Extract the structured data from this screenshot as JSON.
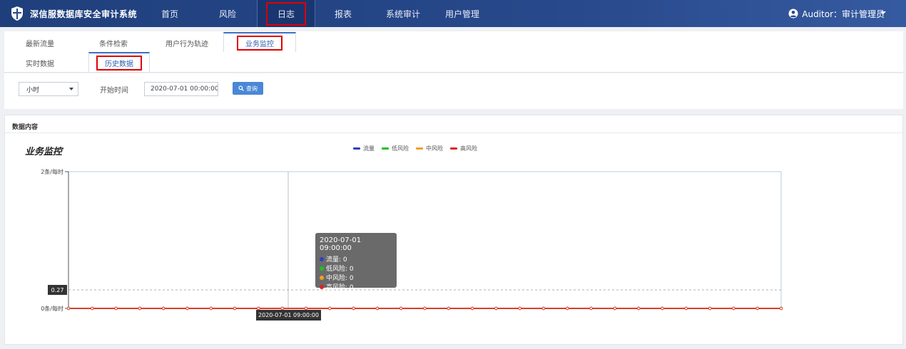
{
  "app": {
    "title": "深信服数据库安全审计系统"
  },
  "nav": {
    "items": [
      "首页",
      "风险",
      "日志",
      "报表",
      "系统审计",
      "用户管理"
    ],
    "active": "日志"
  },
  "user": {
    "label": "Auditor：审计管理员"
  },
  "tabs_row1": [
    "最新流量",
    "条件检索",
    "用户行为轨迹",
    "业务监控"
  ],
  "tabs_row2": [
    "实时数据",
    "历史数据"
  ],
  "filter": {
    "granularity": "小时",
    "start_label": "开始时间",
    "start_value": "2020-07-01 00:00:00",
    "search_label": "查询"
  },
  "panel": {
    "title": "数据内容"
  },
  "tooltip": {
    "time": "2020-07-01 09:00:00",
    "rows": [
      "流量: 0",
      "低风险: 0",
      "中风险: 0",
      "高风险: 0"
    ]
  },
  "crosshair": {
    "y_value": "0.27",
    "x_value": "2020-07-01 09:00:00"
  },
  "colors": {
    "traffic": "#2f3fbf",
    "low": "#1ec21e",
    "mid": "#f0a020",
    "high": "#e02020",
    "nav_bg": "#27488a",
    "accent": "#3b71c4"
  },
  "chart_data": {
    "type": "line",
    "title": "业务监控",
    "yticks": [
      "0条/每时",
      "2条/每时"
    ],
    "ylim": [
      0,
      2
    ],
    "point_count": 31,
    "legend": [
      "流量",
      "低风险",
      "中风险",
      "高风险"
    ],
    "series": [
      {
        "name": "流量",
        "color": "#2f3fbf",
        "values": [
          0,
          0,
          0,
          0,
          0,
          0,
          0,
          0,
          0,
          0,
          0,
          0,
          0,
          0,
          0,
          0,
          0,
          0,
          0,
          0,
          0,
          0,
          0,
          0,
          0,
          0,
          0,
          0,
          0,
          0,
          0
        ]
      },
      {
        "name": "低风险",
        "color": "#1ec21e",
        "values": [
          0,
          0,
          0,
          0,
          0,
          0,
          0,
          0,
          0,
          0,
          0,
          0,
          0,
          0,
          0,
          0,
          0,
          0,
          0,
          0,
          0,
          0,
          0,
          0,
          0,
          0,
          0,
          0,
          0,
          0,
          0
        ]
      },
      {
        "name": "中风险",
        "color": "#f0a020",
        "values": [
          0,
          0,
          0,
          0,
          0,
          0,
          0,
          0,
          0,
          0,
          0,
          0,
          0,
          0,
          0,
          0,
          0,
          0,
          0,
          0,
          0,
          0,
          0,
          0,
          0,
          0,
          0,
          0,
          0,
          0,
          0
        ]
      },
      {
        "name": "高风险",
        "color": "#e02020",
        "values": [
          0,
          0,
          0,
          0,
          0,
          0,
          0,
          0,
          0,
          0,
          0,
          0,
          0,
          0,
          0,
          0,
          0,
          0,
          0,
          0,
          0,
          0,
          0,
          0,
          0,
          0,
          0,
          0,
          0,
          0,
          0
        ]
      }
    ]
  }
}
